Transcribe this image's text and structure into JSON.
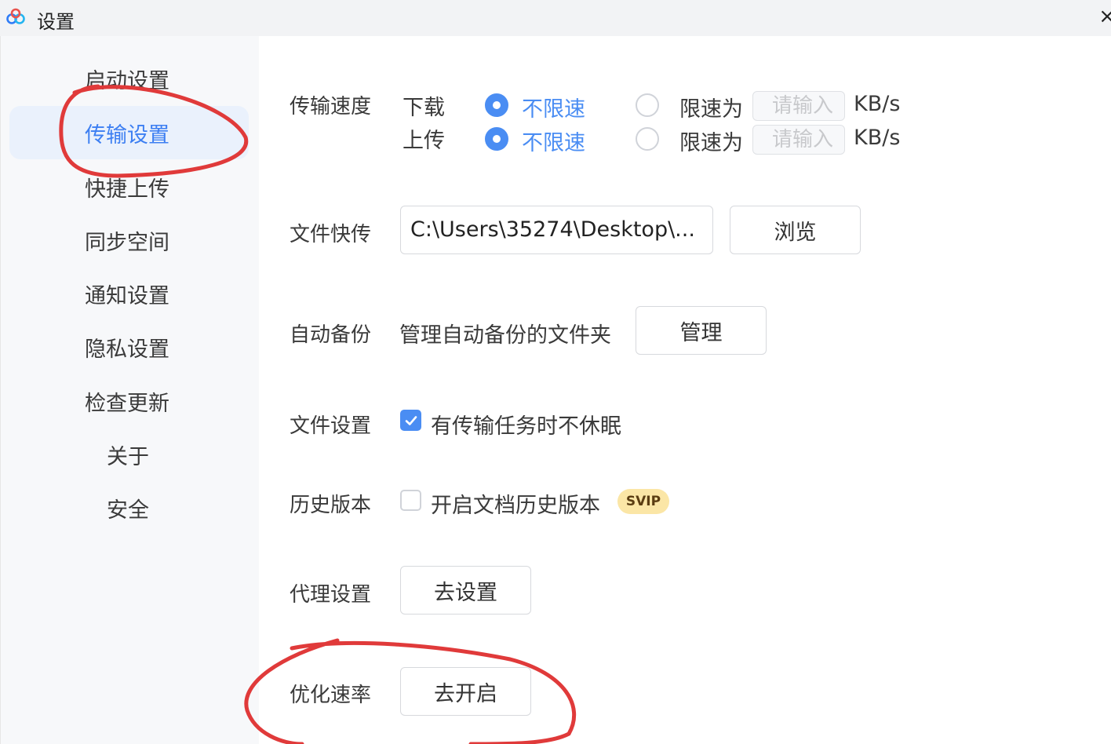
{
  "window": {
    "title": "设置",
    "close_icon": "×"
  },
  "sidebar": {
    "items": [
      {
        "label": "启动设置"
      },
      {
        "label": "传输设置"
      },
      {
        "label": "快捷上传"
      },
      {
        "label": "同步空间"
      },
      {
        "label": "通知设置"
      },
      {
        "label": "隐私设置"
      },
      {
        "label": "检查更新"
      },
      {
        "label": "关于"
      },
      {
        "label": "安全"
      }
    ],
    "active_index": 1
  },
  "speed": {
    "label": "传输速度",
    "download": {
      "label": "下载",
      "unlimited": "不限速",
      "limit": "限速为",
      "placeholder": "请输入",
      "unit": "KB/s",
      "selected": "unlimited"
    },
    "upload": {
      "label": "上传",
      "unlimited": "不限速",
      "limit": "限速为",
      "placeholder": "请输入",
      "unit": "KB/s",
      "selected": "unlimited"
    }
  },
  "quick_upload": {
    "label": "文件快传",
    "path": "C:\\Users\\35274\\Desktop\\...",
    "browse": "浏览"
  },
  "auto_backup": {
    "label": "自动备份",
    "text": "管理自动备份的文件夹",
    "button": "管理"
  },
  "file_settings": {
    "label": "文件设置",
    "checkbox_label": "有传输任务时不休眠",
    "checked": true
  },
  "history": {
    "label": "历史版本",
    "checkbox_label": "开启文档历史版本",
    "checked": false,
    "badge": "SVIP"
  },
  "proxy": {
    "label": "代理设置",
    "button": "去设置"
  },
  "optimize": {
    "label": "优化速率",
    "button": "去开启"
  },
  "colors": {
    "accent": "#4a8df3",
    "annotation": "#e03a3a"
  }
}
